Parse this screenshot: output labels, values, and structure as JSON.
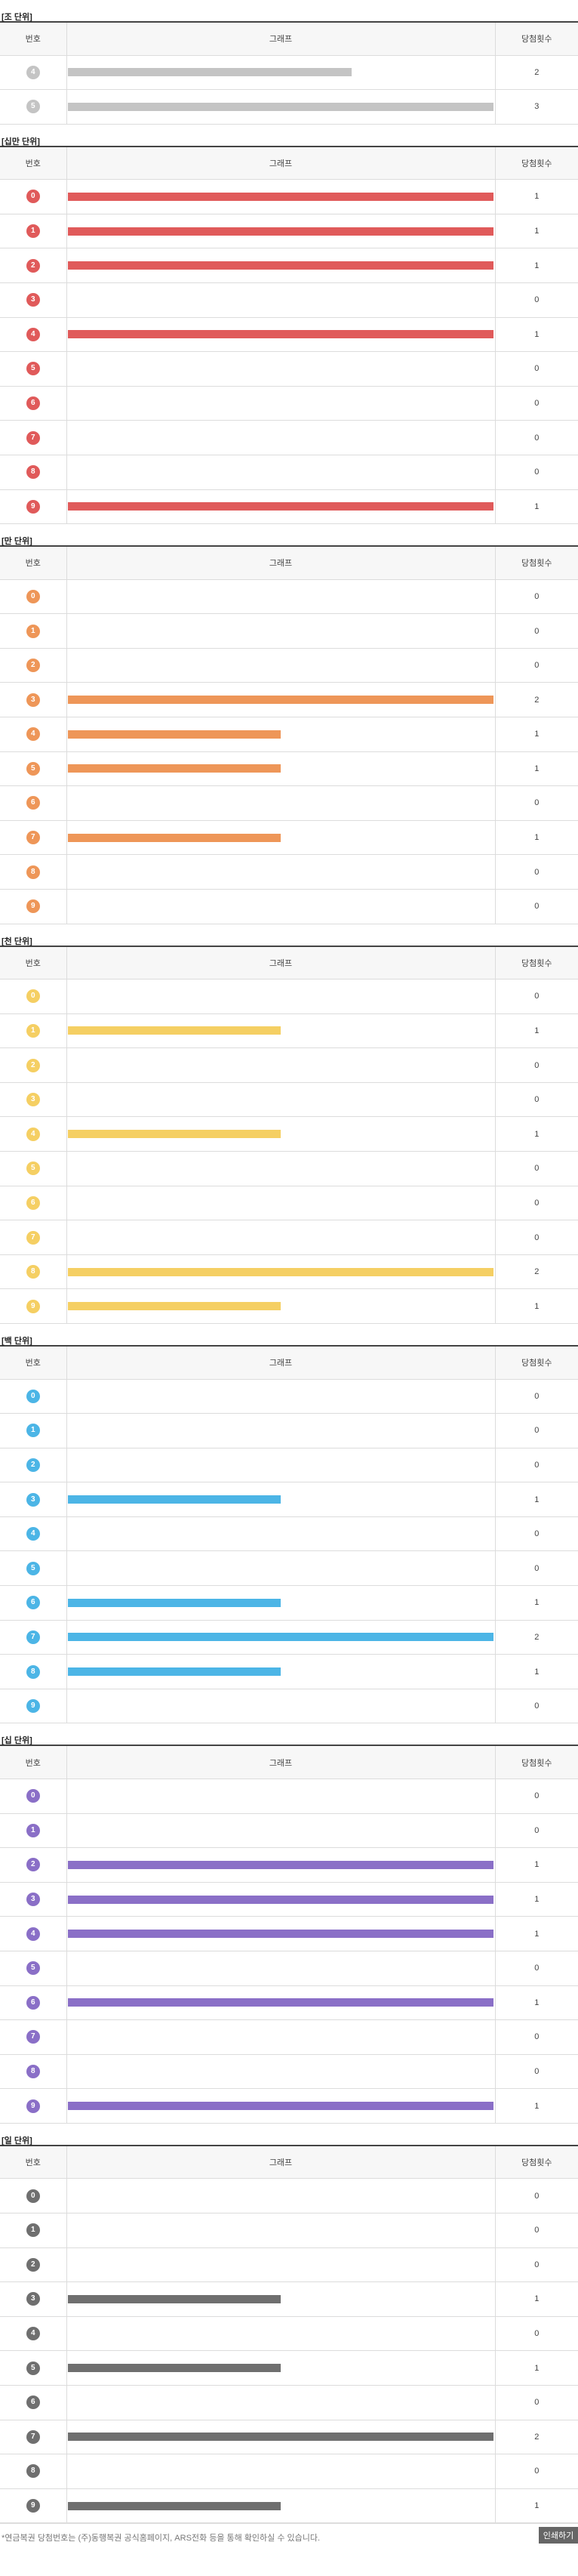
{
  "header": {
    "num": "번호",
    "graph": "그래프",
    "count": "당첨횟수"
  },
  "footer": {
    "note": "*연금복권 당첨번호는 (주)동행복권 공식홈페이지, ARS전화 등을 통해 확인하실 수 있습니다.",
    "print_label": "인쇄하기"
  },
  "sections": [
    {
      "key": "jo",
      "title": "[조 단위]",
      "color": "#c4c4c4",
      "max": 3,
      "rows": [
        {
          "num": "4",
          "count": 2
        },
        {
          "num": "5",
          "count": 3
        }
      ]
    },
    {
      "key": "sip-man",
      "title": "[십만 단위]",
      "color": "#e05a5a",
      "max": 1,
      "rows": [
        {
          "num": "0",
          "count": 1
        },
        {
          "num": "1",
          "count": 1
        },
        {
          "num": "2",
          "count": 1
        },
        {
          "num": "3",
          "count": 0
        },
        {
          "num": "4",
          "count": 1
        },
        {
          "num": "5",
          "count": 0
        },
        {
          "num": "6",
          "count": 0
        },
        {
          "num": "7",
          "count": 0
        },
        {
          "num": "8",
          "count": 0
        },
        {
          "num": "9",
          "count": 1
        }
      ]
    },
    {
      "key": "man",
      "title": "[만 단위]",
      "color": "#ee9658",
      "max": 2,
      "rows": [
        {
          "num": "0",
          "count": 0
        },
        {
          "num": "1",
          "count": 0
        },
        {
          "num": "2",
          "count": 0
        },
        {
          "num": "3",
          "count": 2
        },
        {
          "num": "4",
          "count": 1
        },
        {
          "num": "5",
          "count": 1
        },
        {
          "num": "6",
          "count": 0
        },
        {
          "num": "7",
          "count": 1
        },
        {
          "num": "8",
          "count": 0
        },
        {
          "num": "9",
          "count": 0
        }
      ]
    },
    {
      "key": "cheon",
      "title": "[천 단위]",
      "color": "#f5cf63",
      "max": 2,
      "rows": [
        {
          "num": "0",
          "count": 0
        },
        {
          "num": "1",
          "count": 1
        },
        {
          "num": "2",
          "count": 0
        },
        {
          "num": "3",
          "count": 0
        },
        {
          "num": "4",
          "count": 1
        },
        {
          "num": "5",
          "count": 0
        },
        {
          "num": "6",
          "count": 0
        },
        {
          "num": "7",
          "count": 0
        },
        {
          "num": "8",
          "count": 2
        },
        {
          "num": "9",
          "count": 1
        }
      ]
    },
    {
      "key": "baek",
      "title": "[백 단위]",
      "color": "#4cb5e6",
      "max": 2,
      "rows": [
        {
          "num": "0",
          "count": 0
        },
        {
          "num": "1",
          "count": 0
        },
        {
          "num": "2",
          "count": 0
        },
        {
          "num": "3",
          "count": 1
        },
        {
          "num": "4",
          "count": 0
        },
        {
          "num": "5",
          "count": 0
        },
        {
          "num": "6",
          "count": 1
        },
        {
          "num": "7",
          "count": 2
        },
        {
          "num": "8",
          "count": 1
        },
        {
          "num": "9",
          "count": 0
        }
      ]
    },
    {
      "key": "sip",
      "title": "[십 단위]",
      "color": "#8a6fc7",
      "max": 1,
      "rows": [
        {
          "num": "0",
          "count": 0
        },
        {
          "num": "1",
          "count": 0
        },
        {
          "num": "2",
          "count": 1
        },
        {
          "num": "3",
          "count": 1
        },
        {
          "num": "4",
          "count": 1
        },
        {
          "num": "5",
          "count": 0
        },
        {
          "num": "6",
          "count": 1
        },
        {
          "num": "7",
          "count": 0
        },
        {
          "num": "8",
          "count": 0
        },
        {
          "num": "9",
          "count": 1
        }
      ]
    },
    {
      "key": "il",
      "title": "[일 단위]",
      "color": "#6f6f6f",
      "max": 2,
      "rows": [
        {
          "num": "0",
          "count": 0
        },
        {
          "num": "1",
          "count": 0
        },
        {
          "num": "2",
          "count": 0
        },
        {
          "num": "3",
          "count": 1
        },
        {
          "num": "4",
          "count": 0
        },
        {
          "num": "5",
          "count": 1
        },
        {
          "num": "6",
          "count": 0
        },
        {
          "num": "7",
          "count": 2
        },
        {
          "num": "8",
          "count": 0
        },
        {
          "num": "9",
          "count": 1
        }
      ]
    }
  ]
}
